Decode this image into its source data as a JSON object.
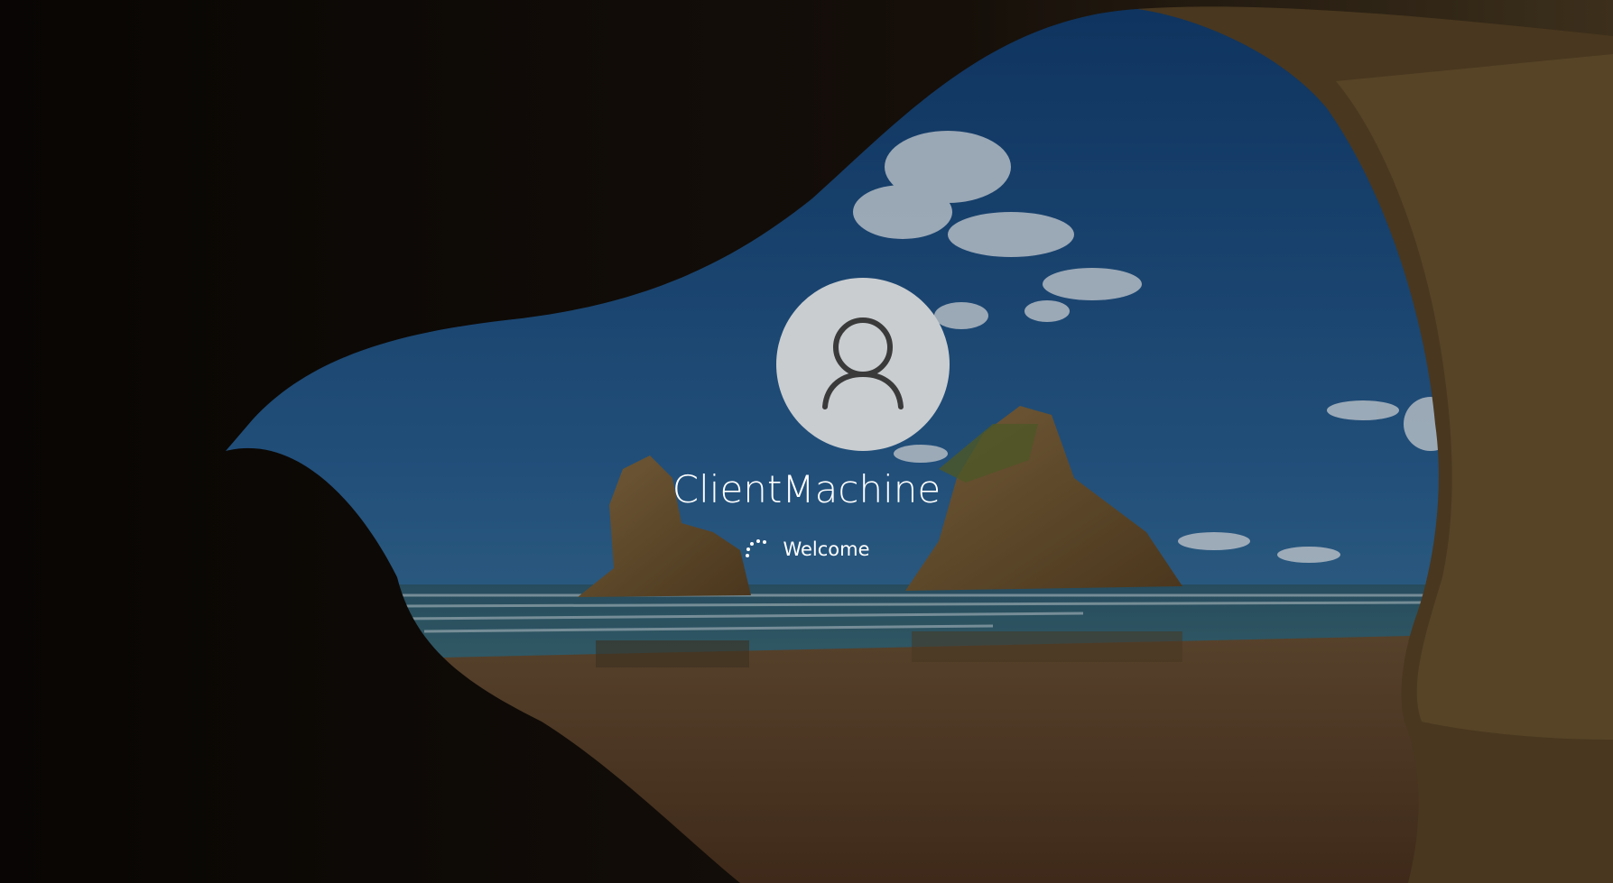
{
  "lock_screen": {
    "background": "cave-beach-wallpaper",
    "avatar_icon": "user-icon",
    "username": "ClientMachine",
    "status_text": "Welcome",
    "status_icon": "loading-spinner-icon"
  },
  "colors": {
    "avatar_bg": "#c9cdd0",
    "avatar_glyph": "#3a3a3a",
    "text": "#ffffff",
    "sky": "#1f5a8e",
    "sand": "#6e4e2a"
  }
}
